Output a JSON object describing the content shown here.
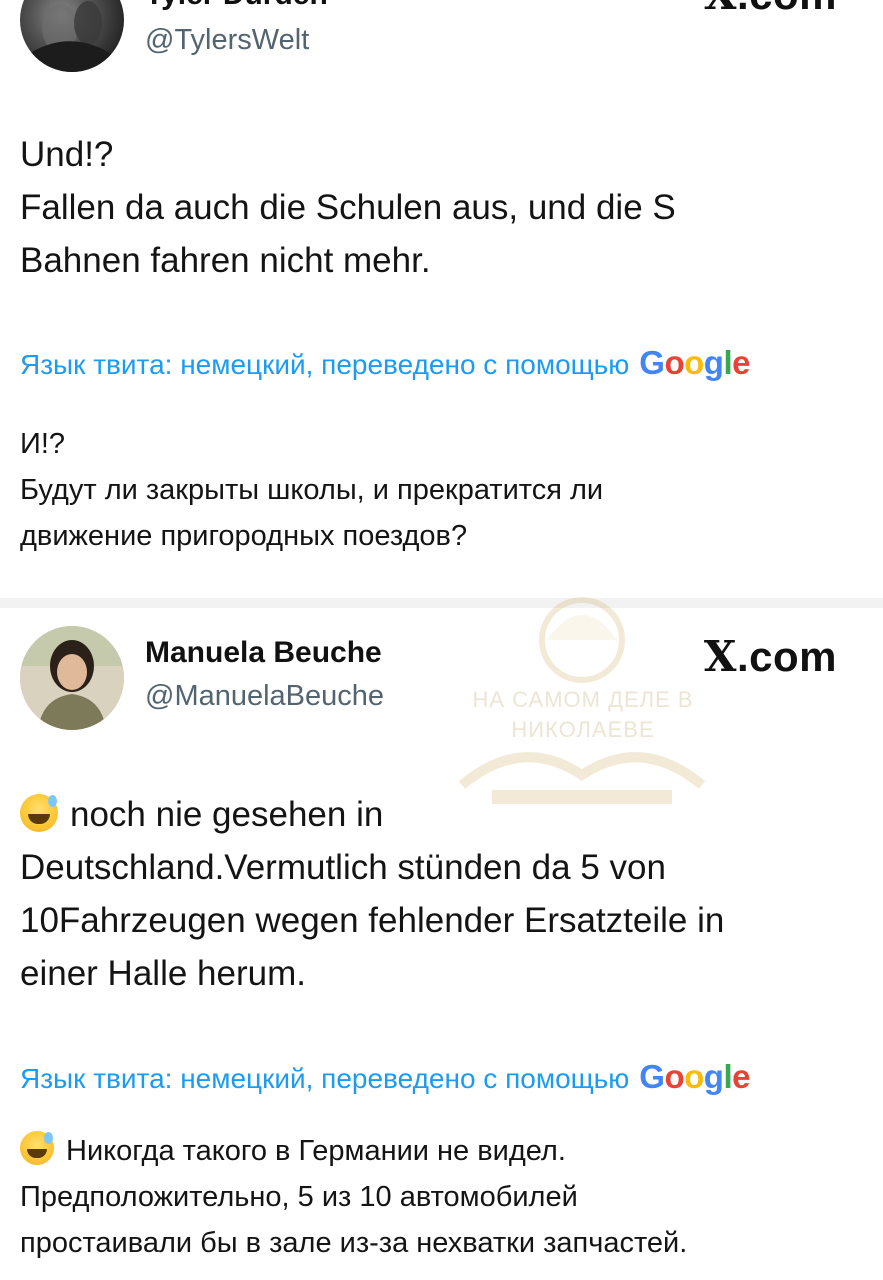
{
  "posts": [
    {
      "author_name": "Tyler Durden",
      "author_handle": "@TylersWelt",
      "source_brand": ".com",
      "source_brand_glyph": "X",
      "original_lines": [
        "Und!?",
        "Fallen da auch die Schulen aus, und die S",
        "Bahnen fahren nicht mehr."
      ],
      "translation_note": "Язык твита: немецкий, переведено с помощью",
      "translation_provider": "Google",
      "translation_lines": [
        "И!?",
        "Будут ли закрыты школы, и прекратится ли",
        "движение пригородных поездов?"
      ]
    },
    {
      "author_name": "Manuela Beuche",
      "author_handle": "@ManuelaBeuche",
      "source_brand": ".com",
      "source_brand_glyph": "X",
      "original_lines": [
        "noch nie gesehen in",
        "Deutschland.Vermutlich stünden da 5  von",
        "10Fahrzeugen wegen fehlender Ersatzteile in",
        "einer Halle herum."
      ],
      "translation_note": "Язык твита: немецкий, переведено с помощью",
      "translation_provider": "Google",
      "translation_lines": [
        "Никогда такого в Германии не видел.",
        "Предположительно, 5 из 10 автомобилей",
        "простаивали бы в зале из-за нехватки запчастей."
      ]
    }
  ],
  "watermark": {
    "line1": "НА САМОМ ДЕЛЕ В",
    "line2": "НИКОЛАЕВЕ"
  },
  "icons": {
    "emoji": "sweat-smile-emoji-icon",
    "brand": "x-logo-icon"
  },
  "colors": {
    "link_blue": "#1d9bf0",
    "handle_gray": "#536471",
    "google_blue": "#4285F4",
    "google_red": "#EA4335",
    "google_yellow": "#FBBC05",
    "google_green": "#34A853"
  }
}
